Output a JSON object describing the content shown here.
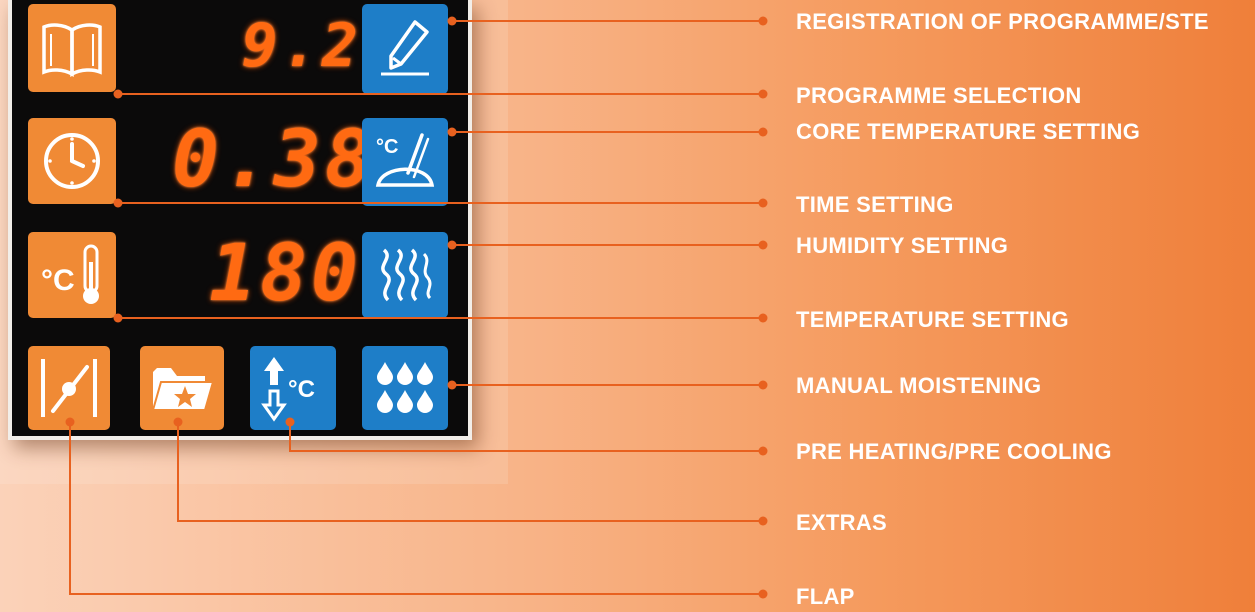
{
  "display": {
    "program_value": "9.2",
    "time_value": "0.38",
    "temperature_value": "180"
  },
  "icons": {
    "program_book": "book-icon",
    "registration": "pencil-icon",
    "clock": "clock-icon",
    "core_temperature": "core-probe-icon",
    "thermometer": "thermometer-icon",
    "humidity": "humidity-waves-icon",
    "flap": "flap-icon",
    "extras": "folder-star-icon",
    "preheat": "preheat-cool-icon",
    "moistening": "water-drops-icon"
  },
  "colors": {
    "orange_button": "#f08a35",
    "blue_button": "#1e7ec8",
    "led_digits": "#ff6a12",
    "leader_lines": "#e8611f"
  },
  "labels": {
    "registration": "REGISTRATION OF PROGRAMME/STE",
    "programme_selection": "PROGRAMME SELECTION",
    "core_temperature": "CORE TEMPERATURE SETTING",
    "time_setting": "TIME SETTING",
    "humidity_setting": "HUMIDITY SETTING",
    "temperature_setting": "TEMPERATURE SETTING",
    "manual_moistening": "MANUAL MOISTENING",
    "pre_heating": "PRE HEATING/PRE COOLING",
    "extras": "EXTRAS",
    "flap": "FLAP"
  }
}
